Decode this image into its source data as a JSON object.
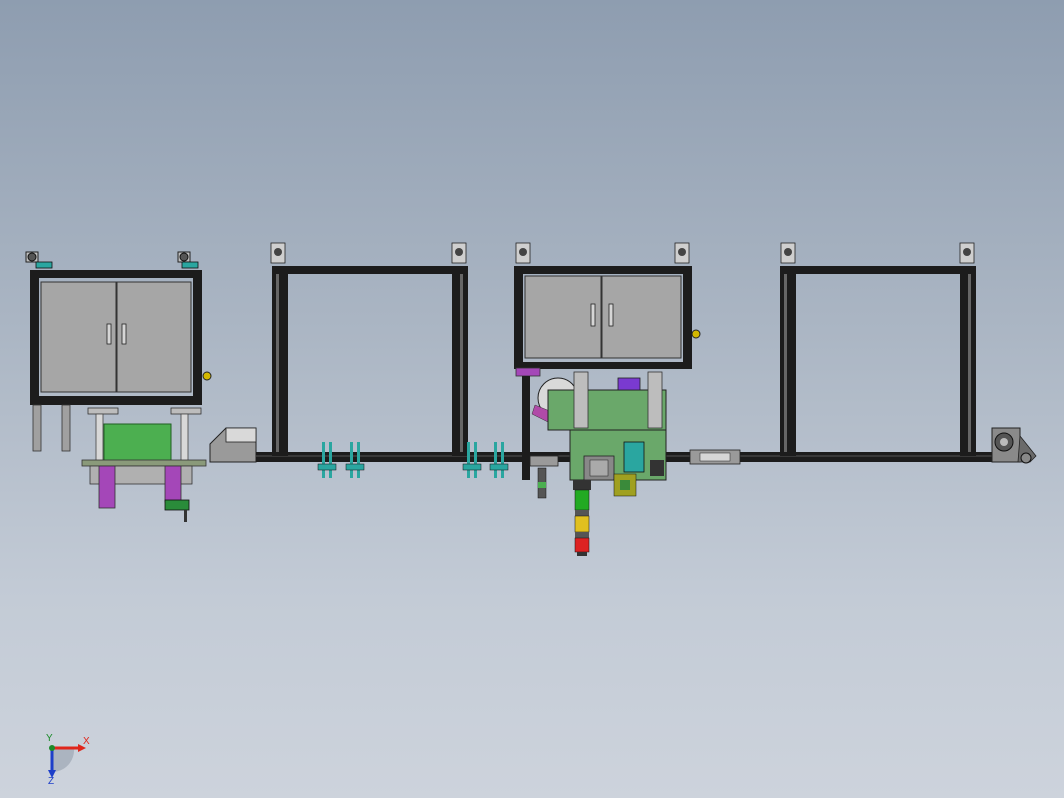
{
  "viewport": {
    "background_top": "#8e9db0",
    "background_bottom": "#cdd3dc"
  },
  "triad": {
    "x_label": "X",
    "y_label": "Y",
    "z_label": "Z",
    "x_color": "#e0261b",
    "y_color": "#1b8a2a",
    "z_color": "#1d3fc9"
  },
  "colors": {
    "frame": "#1c1c1c",
    "cabinet_panel": "#a6a6a6",
    "base_plate_green": "#4caf50",
    "motor_purple": "#a447b8",
    "hopper_gray": "#9a9a9a",
    "board_green": "#6aa86a",
    "tower_green": "#22aa22",
    "tower_yellow": "#e0c020",
    "tower_red": "#dd2222",
    "clamp_cyan": "#2aa6a0"
  },
  "icons": {
    "triad": "coordinate-triad-icon",
    "caster": "caster-wheel-icon",
    "handle": "door-handle-icon"
  }
}
